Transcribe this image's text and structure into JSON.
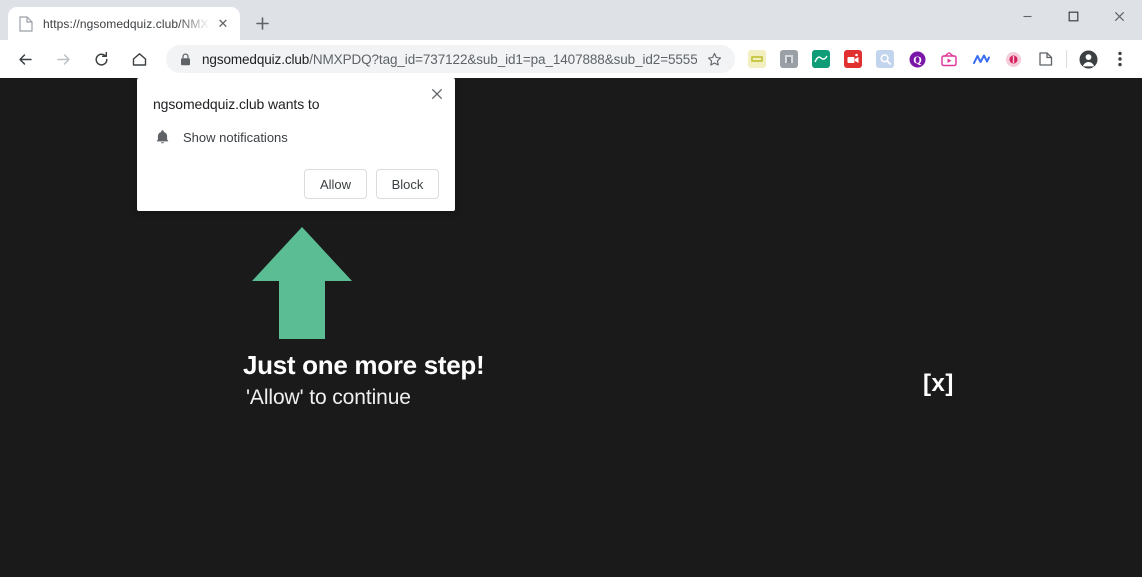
{
  "window": {
    "controls": [
      {
        "name": "minimize",
        "glyph": "–"
      },
      {
        "name": "maximize",
        "glyph": "□"
      },
      {
        "name": "close",
        "glyph": "✕"
      }
    ]
  },
  "tabstrip": {
    "tab": {
      "title": "https://ngsomedquiz.club/NMXP",
      "favicon": "page-icon",
      "close_glyph": "✕"
    },
    "new_tab_glyph": "+"
  },
  "toolbar": {
    "back_glyph": "←",
    "forward_glyph": "→",
    "reload_glyph": "↻",
    "home_glyph": "⌂",
    "star_glyph": "☆",
    "menu_glyph": "⋮",
    "omnibox": {
      "lock_icon": "lock-icon",
      "host": "ngsomedquiz.club",
      "path": "/NMXPDQ?tag_id=737122&sub_id1=pa_1407888&sub_id2=5555…"
    },
    "extensions": [
      {
        "name": "extension-yellow-badge",
        "color": "#f2f0c0",
        "label": "▤"
      },
      {
        "name": "extension-grey-square",
        "color": "#9aa0a6",
        "label": "▣"
      },
      {
        "name": "extension-green-chart",
        "color": "#0f9d77",
        "label": "∩"
      },
      {
        "name": "extension-red-video",
        "color": "#e03030",
        "label": "▤"
      },
      {
        "name": "extension-blue-magnifier",
        "color": "#c3d4ee",
        "label": "⚲"
      },
      {
        "name": "extension-purple-q",
        "color": "#7a16a8",
        "label": "Q"
      },
      {
        "name": "extension-pink-tv",
        "color": "#e0379b",
        "label": "▶"
      },
      {
        "name": "extension-blue-n",
        "color": "#ffffff",
        "label": "N"
      },
      {
        "name": "extension-pink-circle",
        "color": "#f2c6d8",
        "label": "●"
      },
      {
        "name": "extension-share-page",
        "color": "#ffffff",
        "label": "⤡"
      }
    ]
  },
  "permission_dialog": {
    "title": "ngsomedquiz.club wants to",
    "permission_icon": "bell-icon",
    "permission": "Show notifications",
    "allow_label": "Allow",
    "block_label": "Block",
    "close_glyph": "✕"
  },
  "page": {
    "background_color": "#1a1a1a",
    "arrow_color": "#5bbd93",
    "arrow_icon": "arrow-up-icon",
    "headline": "Just one more step!",
    "subline": "'Allow' to continue",
    "close_label": "[x]"
  }
}
